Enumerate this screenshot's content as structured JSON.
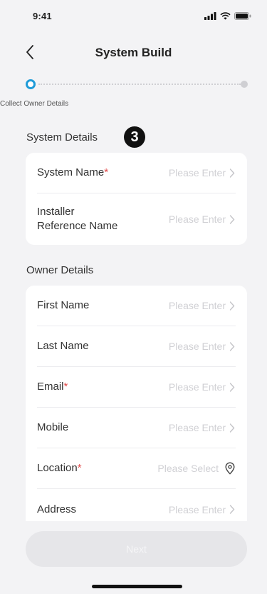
{
  "status_bar": {
    "time": "9:41"
  },
  "header": {
    "title": "System Build"
  },
  "stepper": {
    "label": "Collect Owner Details"
  },
  "annotation": {
    "number": "3"
  },
  "system_details": {
    "title": "System Details",
    "rows": [
      {
        "label": "System Name",
        "required": "*",
        "placeholder": "Please Enter"
      },
      {
        "label_line1": "Installer",
        "label_line2": "Reference Name",
        "placeholder": "Please Enter"
      }
    ]
  },
  "owner_details": {
    "title": "Owner Details",
    "rows": [
      {
        "label": "First Name",
        "placeholder": "Please Enter"
      },
      {
        "label": "Last Name",
        "placeholder": "Please Enter"
      },
      {
        "label": "Email",
        "required": "*",
        "placeholder": "Please Enter"
      },
      {
        "label": "Mobile",
        "placeholder": "Please Enter"
      },
      {
        "label": "Location",
        "required": "*",
        "placeholder": "Please Select"
      },
      {
        "label": "Address",
        "placeholder": "Please Enter"
      }
    ]
  },
  "footer": {
    "next_label": "Next"
  },
  "colors": {
    "accent": "#1f9bd8",
    "required": "#e24b4b",
    "placeholder": "#d0d0d4",
    "background": "#f3f3f5"
  },
  "icons": [
    "signal-icon",
    "wifi-icon",
    "battery-icon",
    "back-chevron-icon",
    "chevron-right-icon",
    "location-pin-icon"
  ]
}
